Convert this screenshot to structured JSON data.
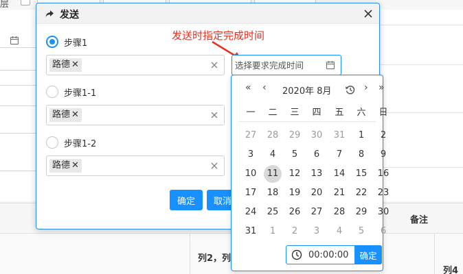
{
  "background": {
    "top_label": "层",
    "column_note": "备注",
    "column_2": "列2，列",
    "column_4": "列4"
  },
  "dialog": {
    "title": "发送",
    "steps": [
      {
        "label": "步骤1",
        "checked": true,
        "tag": "路德"
      },
      {
        "label": "步骤1-1",
        "checked": false,
        "tag": "路德"
      },
      {
        "label": "步骤1-2",
        "checked": false,
        "tag": "路德"
      }
    ],
    "annotation": "发送时指定完成时间",
    "date_placeholder": "选择要求完成时间",
    "confirm_label": "确定",
    "cancel_label": "取消"
  },
  "calendar": {
    "title": "2020年 8月",
    "weekdays": [
      "一",
      "二",
      "三",
      "四",
      "五",
      "六",
      "日"
    ],
    "weeks": [
      [
        "27",
        "28",
        "29",
        "30",
        "31",
        "1",
        "2"
      ],
      [
        "3",
        "4",
        "5",
        "6",
        "7",
        "8",
        "9"
      ],
      [
        "10",
        "11",
        "12",
        "13",
        "14",
        "15",
        "16"
      ],
      [
        "17",
        "18",
        "19",
        "20",
        "21",
        "22",
        "23"
      ],
      [
        "24",
        "25",
        "26",
        "27",
        "28",
        "29",
        "30"
      ],
      [
        "31",
        "1",
        "2",
        "3",
        "4",
        "5",
        "6"
      ]
    ],
    "today": "11",
    "time_value": "00:00:00",
    "time_ok_label": "确定"
  }
}
